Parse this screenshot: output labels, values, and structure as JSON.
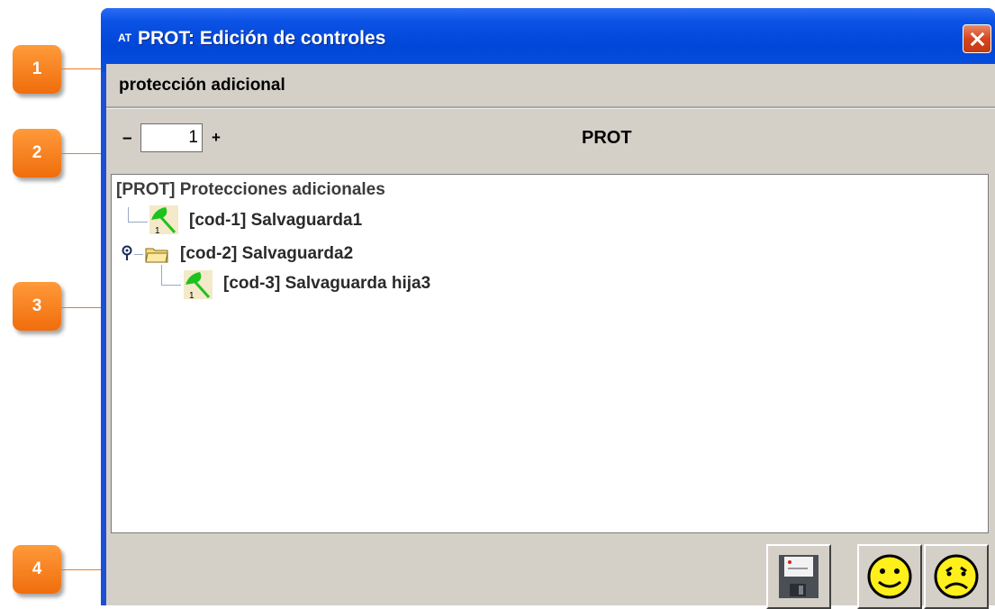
{
  "window": {
    "app_badge": "AT",
    "title": "PROT: Edición de controles",
    "section_label": "protección adicional",
    "stepper": {
      "minus": "–",
      "value": "1",
      "plus": "+"
    },
    "code": "PROT"
  },
  "tree": {
    "root": "[PROT] Protecciones adicionales",
    "items": [
      {
        "label": "[cod-1] Salvaguarda1",
        "icon": "umbrella-icon"
      },
      {
        "label": "[cod-2] Salvaguarda2",
        "icon": "folder-icon"
      },
      {
        "label": "[cod-3] Salvaguarda hija3",
        "icon": "umbrella-icon"
      }
    ]
  },
  "buttons": [
    {
      "name": "save-button",
      "icon": "floppy-disk-icon"
    },
    {
      "name": "accept-button",
      "icon": "happy-face-icon"
    },
    {
      "name": "cancel-button",
      "icon": "sad-face-icon"
    }
  ],
  "callouts": [
    "1",
    "2",
    "3",
    "4"
  ],
  "colors": {
    "callout": "#f07a20",
    "titlebar": "#0047d8",
    "panel": "#d4d0c8"
  }
}
